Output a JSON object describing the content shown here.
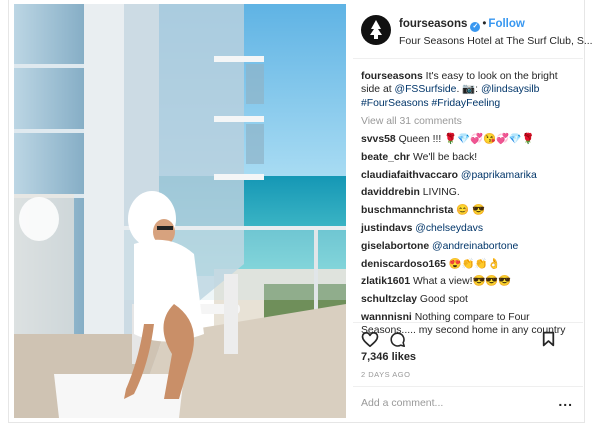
{
  "post": {
    "username": "fourseasons",
    "follow_label": "Follow",
    "dot": "•",
    "location": "Four Seasons Hotel at The Surf Club, S...",
    "caption": {
      "user": "fourseasons",
      "text_1": " It's easy to look on the bright side at ",
      "mention_1": "@FSSurfside",
      "text_2": ". 📷: ",
      "mention_2": "@lindsaysilb",
      "hashtag_1": "#FourSeasons",
      "hashtag_2": "#FridayFeeling"
    },
    "view_all": "View all 31 comments",
    "comments": [
      {
        "user": "svvs58",
        "text": " Queen !!! 🌹💎💞😘💞💎🌹",
        "mention": ""
      },
      {
        "user": "beate_chr",
        "text": " We'll be back!",
        "mention": ""
      },
      {
        "user": "claudiafaithvaccaro",
        "text": " ",
        "mention": "@paprikamarika"
      },
      {
        "user": "daviddrebin",
        "text": " LIVING.",
        "mention": ""
      },
      {
        "user": "buschmannchrista",
        "text": " 😊 😎",
        "mention": ""
      },
      {
        "user": "justindavs",
        "text": " ",
        "mention": "@chelseydavs"
      },
      {
        "user": "giselabortone",
        "text": " ",
        "mention": "@andreinabortone"
      },
      {
        "user": "deniscardoso165",
        "text": " 😍👏👏👌",
        "mention": ""
      },
      {
        "user": "zlatik1601",
        "text": " What a view!😎😎😎",
        "mention": ""
      },
      {
        "user": "schultzclay",
        "text": " Good spot",
        "mention": ""
      },
      {
        "user": "wannnisni",
        "text": " Nothing compare to Four Seasons..... my second home in any country",
        "mention": ""
      }
    ],
    "likes": "7,346 likes",
    "time_ago": "2 DAYS AGO",
    "add_comment_placeholder": "Add a comment...",
    "more_label": "..."
  },
  "icons": {
    "heart": "heart-icon",
    "comment": "comment-icon",
    "bookmark": "bookmark-icon",
    "verified": "verified-badge-icon",
    "avatar": "four-seasons-tree-logo"
  },
  "colors": {
    "sky": "#7cc4ea",
    "ocean": "#2fb3c4",
    "link": "#3897f0",
    "mention": "#003569"
  }
}
